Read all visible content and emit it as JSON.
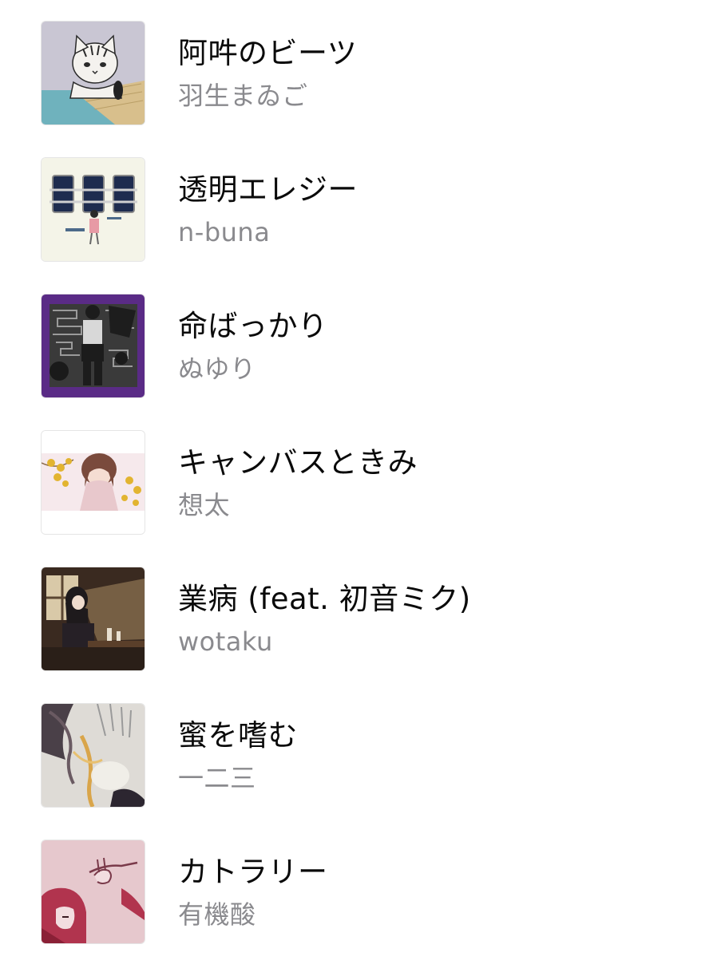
{
  "tracks": [
    {
      "title": "阿吽のビーツ",
      "artist": "羽生まゐご",
      "artwork_icon": "cat-album-art-icon"
    },
    {
      "title": "透明エレジー",
      "artist": "n-buna",
      "artwork_icon": "train-windows-album-art-icon"
    },
    {
      "title": "命ばっかり",
      "artist": "ぬゆり",
      "artwork_icon": "dark-figure-album-art-icon"
    },
    {
      "title": "キャンバスときみ",
      "artist": "想太",
      "artwork_icon": "flower-girl-album-art-icon"
    },
    {
      "title": "業病 (feat. 初音ミク)",
      "artist": "wotaku",
      "artwork_icon": "classroom-girl-album-art-icon"
    },
    {
      "title": "蜜を嗜む",
      "artist": "一二三",
      "artwork_icon": "honey-abstract-album-art-icon"
    },
    {
      "title": "カトラリー",
      "artist": "有機酸",
      "artwork_icon": "pink-hand-album-art-icon"
    }
  ],
  "colors": {
    "title": "#0a0a0a",
    "artist": "#8a8a8e",
    "background": "#ffffff"
  }
}
